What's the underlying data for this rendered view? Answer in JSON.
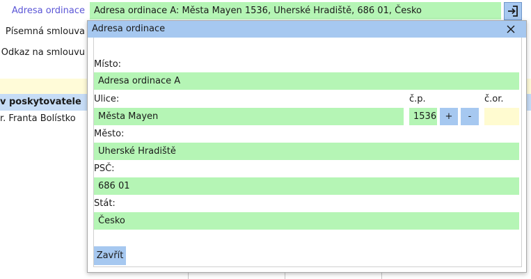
{
  "background": {
    "address_label": "Adresa ordinace",
    "address_value": "Adresa ordinace A: Města Mayen 1536, Uherské Hradiště, 686 01, Česko",
    "written_contract_label": "Písemná smlouva",
    "contract_link_label": "Odkaz na smlouvu",
    "provider_header": "v poskytovatele",
    "provider_row": "r. Franta Bolístko"
  },
  "dialog": {
    "title": "Adresa ordinace",
    "place_label": "Místo:",
    "place_value": "Adresa ordinace A",
    "street_label": "Ulice:",
    "street_value": "Města Mayen",
    "cp_label": "č.p.",
    "cp_value": "1536",
    "plus_label": "+",
    "minus_label": "-",
    "cor_label": "č.or.",
    "cor_value": "",
    "city_label": "Město:",
    "city_value": "Uherské Hradiště",
    "zip_label": "PSČ:",
    "zip_value": "686 01",
    "country_label": "Stát:",
    "country_value": "Česko",
    "close_button": "Zavřít"
  },
  "colors": {
    "field_green": "#b5f5b5",
    "button_blue": "#a6c8f0",
    "link_blue": "#5a55d6",
    "field_yellow": "#fffbd0"
  },
  "icons": [
    "login-icon",
    "close-icon"
  ]
}
